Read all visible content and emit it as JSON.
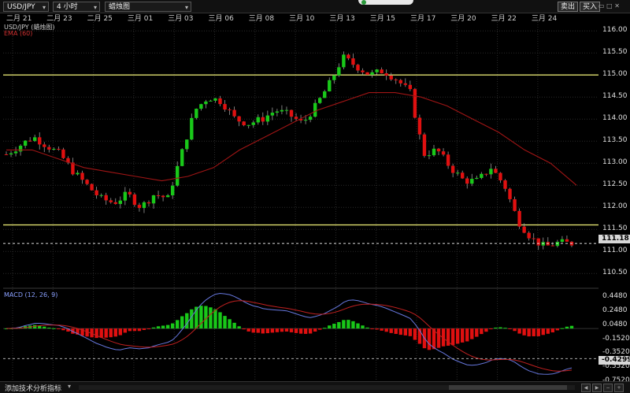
{
  "toolbar": {
    "symbol": "USD/JPY",
    "timeframe": "4 小时",
    "chart_type": "蜡烛图",
    "sell_label": "卖出",
    "buy_label": "买入"
  },
  "date_labels": [
    "二月 21",
    "二月 23",
    "二月 25",
    "三月 01",
    "三月 03",
    "三月 06",
    "三月 08",
    "三月 10",
    "三月 13",
    "三月 15",
    "三月 17",
    "三月 20",
    "三月 22",
    "三月 24"
  ],
  "main_panel": {
    "symbol_legend": "USD/JPY (蜡烛图)",
    "ema_legend": "EMA (60)",
    "price_ticks": [
      "116.00",
      "115.50",
      "115.00",
      "114.50",
      "114.00",
      "113.50",
      "113.00",
      "112.50",
      "112.00",
      "111.50",
      "111.00",
      "110.50"
    ],
    "current_price": "111.18",
    "horizontal_lines": [
      115.0,
      111.6
    ]
  },
  "macd_panel": {
    "legend": "MACD (12, 26, 9)",
    "ticks": [
      "0.4480",
      "0.2480",
      "0.0480",
      "-0.1520",
      "-0.3520",
      "-0.5520",
      "-0.7520"
    ],
    "current_value": "-0.4299"
  },
  "status": {
    "add_indicator": "添加技术分析指标"
  },
  "colors": {
    "bull": "#19c819",
    "bear": "#e01010",
    "ema": "#a01515",
    "support": "#e0e070",
    "macd_line": "#6677dd",
    "signal_line": "#c02020"
  },
  "chart_data": {
    "type": "candlestick",
    "title": "USD/JPY 4 小时",
    "y_range": [
      110.2,
      116.2
    ],
    "approx_close_path": [
      113.2,
      113.4,
      113.6,
      113.4,
      113.2,
      112.8,
      112.5,
      112.2,
      112.1,
      112.3,
      112.0,
      112.3,
      112.2,
      113.2,
      114.2,
      114.5,
      114.4,
      114.0,
      113.9,
      114.0,
      114.2,
      114.1,
      113.9,
      114.3,
      114.8,
      115.4,
      115.2,
      115.0,
      115.1,
      114.9,
      114.6,
      113.2,
      113.3,
      112.9,
      112.6,
      112.6,
      112.9,
      112.5,
      111.7,
      111.3,
      111.1,
      111.2,
      111.18
    ],
    "ema_path": [
      113.3,
      113.3,
      113.1,
      112.9,
      112.8,
      112.7,
      112.6,
      112.7,
      112.9,
      113.3,
      113.6,
      113.9,
      114.2,
      114.4,
      114.6,
      114.6,
      114.5,
      114.3,
      114.0,
      113.7,
      113.3,
      113.0,
      112.5
    ],
    "support_levels": [
      115.0,
      111.6
    ],
    "current_price": 111.18,
    "macd": {
      "name": "MACD (12, 26, 9)",
      "y_range": [
        -0.75,
        0.55
      ],
      "current": -0.4299
    }
  }
}
